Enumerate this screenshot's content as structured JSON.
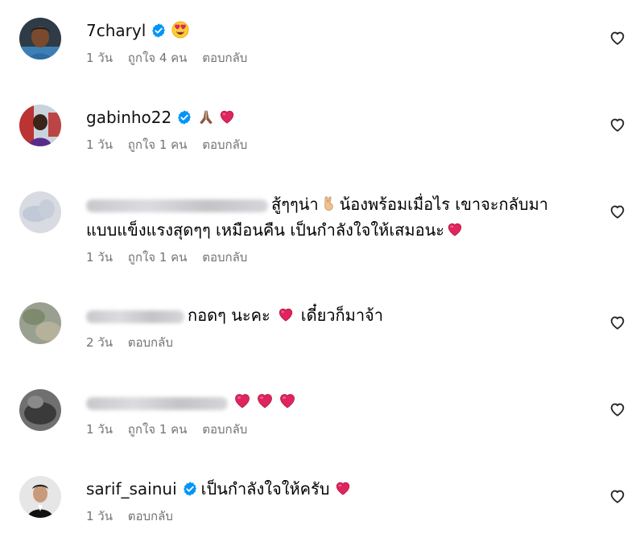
{
  "comments": [
    {
      "username": "7charyl",
      "verified": true,
      "text": "",
      "emojis": [
        "heart-eyes"
      ],
      "time": "1 วัน",
      "likes": "ถูกใจ 4 คน",
      "reply": "ตอบกลับ"
    },
    {
      "username": "gabinho22",
      "verified": true,
      "text": "",
      "emojis": [
        "folded-hands",
        "red-heart"
      ],
      "time": "1 วัน",
      "likes": "ถูกใจ 1 คน",
      "reply": "ตอบกลับ"
    },
    {
      "username_blurred": true,
      "text_line1": "สู้ๆๆน่า",
      "text_line1b": "น้องพร้อมเมื่อไร เขาจะกลับมา",
      "text_line2": "แบบแข็งแรงสุดๆๆ เหมือนคืน เป็นกำลังใจให้เสมอนะ",
      "time": "1 วัน",
      "likes": "ถูกใจ 1 คน",
      "reply": "ตอบกลับ"
    },
    {
      "username_blurred": true,
      "text_a": "กอดๆ นะคะ",
      "text_b": "เดี๋ยวก็มาจ้า",
      "time": "2 วัน",
      "reply": "ตอบกลับ"
    },
    {
      "username_blurred": true,
      "emojis": [
        "red-heart",
        "red-heart",
        "red-heart"
      ],
      "time": "1 วัน",
      "likes": "ถูกใจ 1 คน",
      "reply": "ตอบกลับ"
    },
    {
      "username": "sarif_sainui",
      "verified": true,
      "text": "เป็นกำลังใจให้ครับ",
      "emojis": [
        "red-heart"
      ],
      "time": "1 วัน",
      "reply": "ตอบกลับ"
    }
  ],
  "colors": {
    "verified": "#0095f6",
    "meta": "#737373",
    "heart": "#e0245e"
  }
}
